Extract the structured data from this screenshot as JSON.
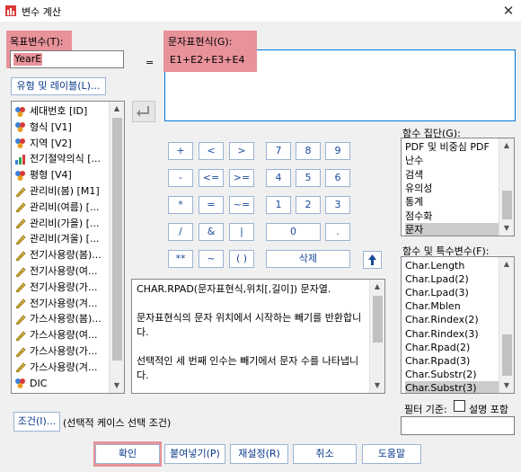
{
  "window": {
    "title": "변수 계산",
    "close_glyph": "✕"
  },
  "target": {
    "label": "목표변수(T):",
    "value": "YearE"
  },
  "equals": "=",
  "expression": {
    "label": "문자표현식(G):",
    "value": "E1+E2+E3+E4"
  },
  "type_label_button": "유형 및 레이블(L)...",
  "variables": [
    {
      "name": "세대번호 [ID]",
      "icon": "nominal-icon"
    },
    {
      "name": "형식 [V1]",
      "icon": "nominal-icon"
    },
    {
      "name": "지역 [V2]",
      "icon": "nominal-icon"
    },
    {
      "name": "전기절약의식 [...",
      "icon": "ordinal-icon"
    },
    {
      "name": "평형 [V4]",
      "icon": "nominal-icon"
    },
    {
      "name": "관리비(봄) [M1]",
      "icon": "scale-icon"
    },
    {
      "name": "관리비(여름) [...",
      "icon": "scale-icon"
    },
    {
      "name": "관리비(가을) [...",
      "icon": "scale-icon"
    },
    {
      "name": "관리비(겨울) [...",
      "icon": "scale-icon"
    },
    {
      "name": "전기사용량(봄)...",
      "icon": "scale-icon"
    },
    {
      "name": "전기사용량(여...",
      "icon": "scale-icon"
    },
    {
      "name": "전기사용량(가...",
      "icon": "scale-icon"
    },
    {
      "name": "전기사용량(겨...",
      "icon": "scale-icon"
    },
    {
      "name": "가스사용량(봄)...",
      "icon": "scale-icon"
    },
    {
      "name": "가스사용량(여...",
      "icon": "scale-icon"
    },
    {
      "name": "가스사용량(가...",
      "icon": "scale-icon"
    },
    {
      "name": "가스사용량(겨...",
      "icon": "scale-icon"
    },
    {
      "name": "DIC",
      "icon": "nominal-icon"
    }
  ],
  "keypad": {
    "plus": "+",
    "lt": "<",
    "gt": ">",
    "seven": "7",
    "eight": "8",
    "nine": "9",
    "minus": "-",
    "le": "<=",
    "ge": ">=",
    "four": "4",
    "five": "5",
    "six": "6",
    "times": "*",
    "eq": "=",
    "ne": "~=",
    "one": "1",
    "two": "2",
    "three": "3",
    "divide": "/",
    "and": "&",
    "or": "|",
    "zero": "0",
    "dot": ".",
    "power": "**",
    "not": "~",
    "paren": "( )",
    "delete": "삭제"
  },
  "description": "CHAR.RPAD(문자표현식,위치[,길이]) 문자열.\n\n문자표현식의 문자 위치에서 시작하는 빼기를 반환합니다.\n\n선택적인 세 번째 인수는 빼기에서 문자 수를 나타냅니다.",
  "function_groups": {
    "label": "함수 집단(G):",
    "items": [
      "PDF 및 비중심 PDF",
      "난수",
      "검색",
      "유의성",
      "통계",
      "점수화",
      "문자"
    ],
    "selected": "문자"
  },
  "functions": {
    "label": "함수 및 특수변수(F):",
    "items": [
      "Char.Length",
      "Char.Lpad(2)",
      "Char.Lpad(3)",
      "Char.Mblen",
      "Char.Rindex(2)",
      "Char.Rindex(3)",
      "Char.Rpad(2)",
      "Char.Rpad(3)",
      "Char.Substr(2)",
      "Char.Substr(3)"
    ],
    "selected": "Char.Substr(3)"
  },
  "filter": {
    "label": "필터 기준:",
    "checkbox_label": "설명 포함",
    "checked": false,
    "value": ""
  },
  "condition": {
    "button": "조건(I)...",
    "text": "(선택적 케이스 선택 조건)"
  },
  "buttons": {
    "ok": "확인",
    "paste": "붙여넣기(P)",
    "reset": "재설정(R)",
    "cancel": "취소",
    "help": "도움말"
  },
  "colors": {
    "highlight": "#e8929a",
    "accent": "#1a4a9a",
    "selection": "#cccccc"
  }
}
